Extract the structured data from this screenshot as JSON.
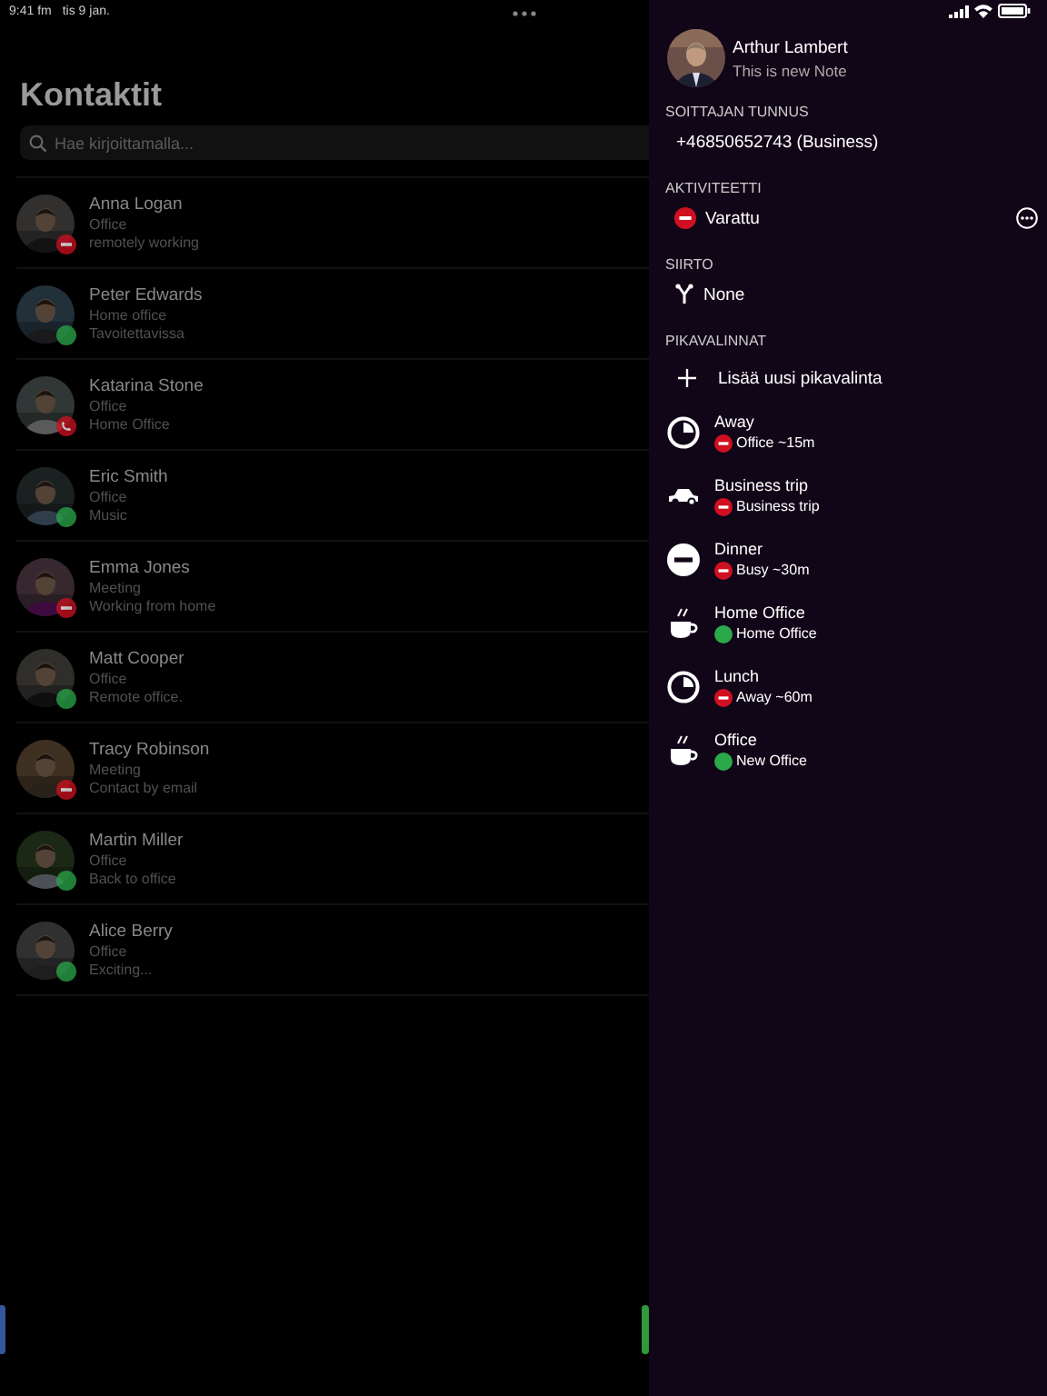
{
  "status_bar": {
    "time": "9:41 fm",
    "date": "tis 9 jan."
  },
  "contacts": {
    "title": "Kontaktit",
    "search": {
      "placeholder": "Hae kirjoittamalla..."
    },
    "rows": [
      {
        "name": "Anna Logan",
        "location": "Office",
        "note": "remotely working",
        "kind": "busy"
      },
      {
        "name": "Peter Edwards",
        "location": "Home office",
        "note": "Tavoitettavissa",
        "kind": "available"
      },
      {
        "name": "Katarina Stone",
        "location": "Office",
        "note": "Home Office",
        "kind": "call"
      },
      {
        "name": "Eric Smith",
        "location": "Office",
        "note": "Music",
        "kind": "available"
      },
      {
        "name": "Emma Jones",
        "location": "Meeting",
        "note": "Working from home",
        "kind": "busy"
      },
      {
        "name": "Matt Cooper",
        "location": "Office",
        "note": "Remote office.",
        "kind": "available"
      },
      {
        "name": "Tracy Robinson",
        "location": "Meeting",
        "note": "Contact by email",
        "kind": "busy"
      },
      {
        "name": "Martin Miller",
        "location": "Office",
        "note": "Back to office",
        "kind": "available"
      },
      {
        "name": "Alice Berry",
        "location": "Office",
        "note": "Exciting...",
        "kind": "available"
      }
    ]
  },
  "profile": {
    "name": "Arthur Lambert",
    "note": "This is new Note",
    "caller_id": {
      "heading": "SOITTAJAN TUNNUS",
      "value": "+46850652743 (Business)"
    },
    "activity": {
      "heading": "AKTIVITEETTI",
      "kind": "busy",
      "value": "Varattu"
    },
    "transfer": {
      "heading": "SIIRTO",
      "value": "None"
    },
    "shortcuts": {
      "heading": "PIKAVALINNAT",
      "add_label": "Lisää uusi pikavalinta",
      "items": [
        {
          "kind": "clock",
          "title": "Away",
          "status": {
            "kind": "busy",
            "detail": "Office ~15m"
          }
        },
        {
          "kind": "car",
          "title": "Business trip",
          "status": {
            "kind": "busy",
            "detail": "Business trip"
          }
        },
        {
          "kind": "minus",
          "title": "Dinner",
          "status": {
            "kind": "busy",
            "detail": "Busy ~30m"
          }
        },
        {
          "kind": "cup",
          "title": "Home Office",
          "status": {
            "kind": "available",
            "detail": "Home Office"
          }
        },
        {
          "kind": "clock",
          "title": "Lunch",
          "status": {
            "kind": "busy",
            "detail": "Away ~60m"
          }
        },
        {
          "kind": "cup",
          "title": "Office",
          "status": {
            "kind": "available",
            "detail": "New Office"
          }
        }
      ]
    }
  }
}
